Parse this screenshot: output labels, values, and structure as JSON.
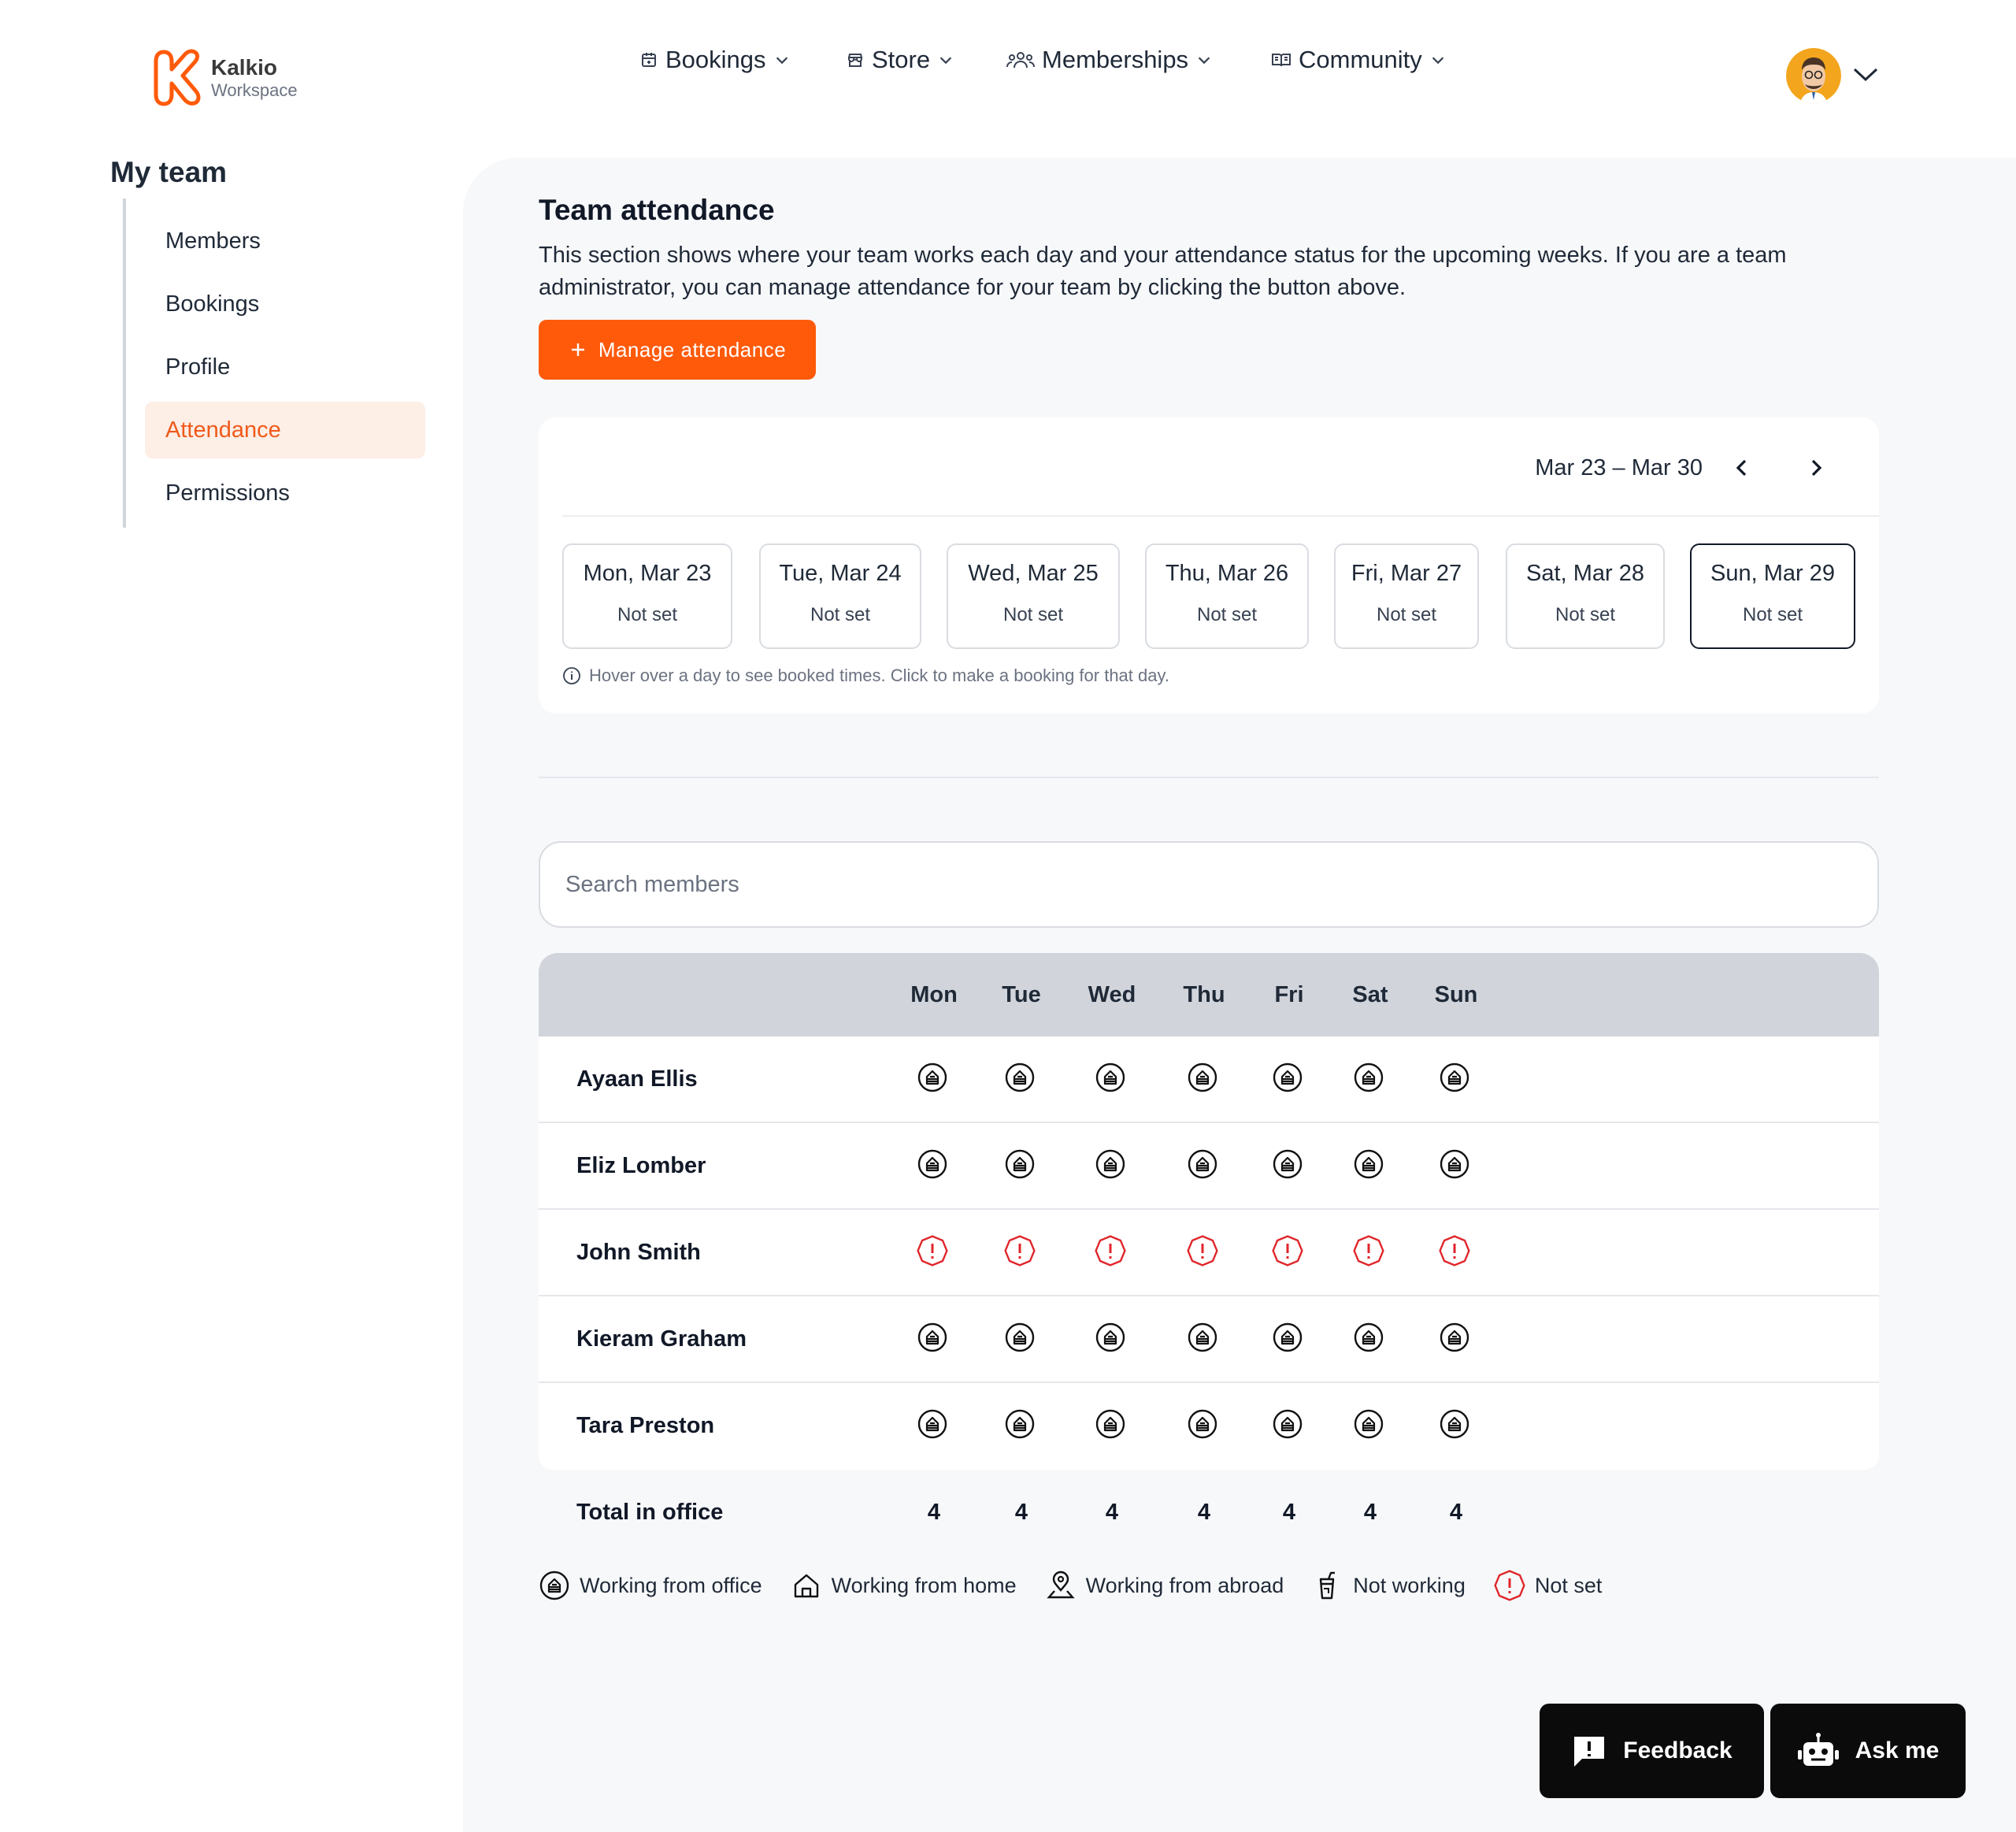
{
  "brand": {
    "name": "Kalkio",
    "sub": "Workspace",
    "accent": "#ff5a0a"
  },
  "nav": {
    "bookings": "Bookings",
    "store": "Store",
    "memberships": "Memberships",
    "community": "Community"
  },
  "sidebar": {
    "title": "My team",
    "items": [
      {
        "label": "Members"
      },
      {
        "label": "Bookings"
      },
      {
        "label": "Profile"
      },
      {
        "label": "Attendance",
        "active": true
      },
      {
        "label": "Permissions"
      }
    ]
  },
  "attendance": {
    "title": "Team attendance",
    "description": "This section shows where your team works each day and your attendance status for the upcoming weeks. If you are a team administrator, you can manage attendance for your team by clicking the button above.",
    "manage_label": "Manage attendance",
    "week_range": "Mar 23 – Mar 30",
    "days": [
      {
        "date": "Mon, Mar 23",
        "status": "Not set"
      },
      {
        "date": "Tue, Mar 24",
        "status": "Not set"
      },
      {
        "date": "Wed, Mar 25",
        "status": "Not set"
      },
      {
        "date": "Thu, Mar 26",
        "status": "Not set"
      },
      {
        "date": "Fri, Mar 27",
        "status": "Not set"
      },
      {
        "date": "Sat, Mar 28",
        "status": "Not set"
      },
      {
        "date": "Sun, Mar 29",
        "status": "Not set",
        "selected": true
      }
    ],
    "hint": "Hover over a day to see booked times. Click to make a booking for that day."
  },
  "search": {
    "placeholder": "Search members"
  },
  "table": {
    "columns": [
      "Mon",
      "Tue",
      "Wed",
      "Thu",
      "Fri",
      "Sat",
      "Sun"
    ],
    "rows": [
      {
        "name": "Ayaan Ellis",
        "statuses": [
          "office",
          "office",
          "office",
          "office",
          "office",
          "office",
          "office"
        ]
      },
      {
        "name": "Eliz Lomber",
        "statuses": [
          "office",
          "office",
          "office",
          "office",
          "office",
          "office",
          "office"
        ]
      },
      {
        "name": "John Smith",
        "statuses": [
          "notset",
          "notset",
          "notset",
          "notset",
          "notset",
          "notset",
          "notset"
        ]
      },
      {
        "name": "Kieram Graham",
        "statuses": [
          "office",
          "office",
          "office",
          "office",
          "office",
          "office",
          "office"
        ]
      },
      {
        "name": "Tara Preston",
        "statuses": [
          "office",
          "office",
          "office",
          "office",
          "office",
          "office",
          "office"
        ]
      }
    ],
    "total_label": "Total in office",
    "totals": [
      "4",
      "4",
      "4",
      "4",
      "4",
      "4",
      "4"
    ]
  },
  "legend": [
    {
      "icon": "office-icon",
      "label": "Working from office"
    },
    {
      "icon": "home-icon",
      "label": "Working from home"
    },
    {
      "icon": "location-pin-icon",
      "label": "Working from abroad"
    },
    {
      "icon": "drink-icon",
      "label": "Not working"
    },
    {
      "icon": "alert-icon",
      "label": "Not set"
    }
  ],
  "actions": {
    "feedback": "Feedback",
    "ask_me": "Ask me"
  },
  "colors": {
    "not_set": "#e0262b",
    "table_header": "#d1d5db",
    "active_bg": "#fdeee6"
  }
}
